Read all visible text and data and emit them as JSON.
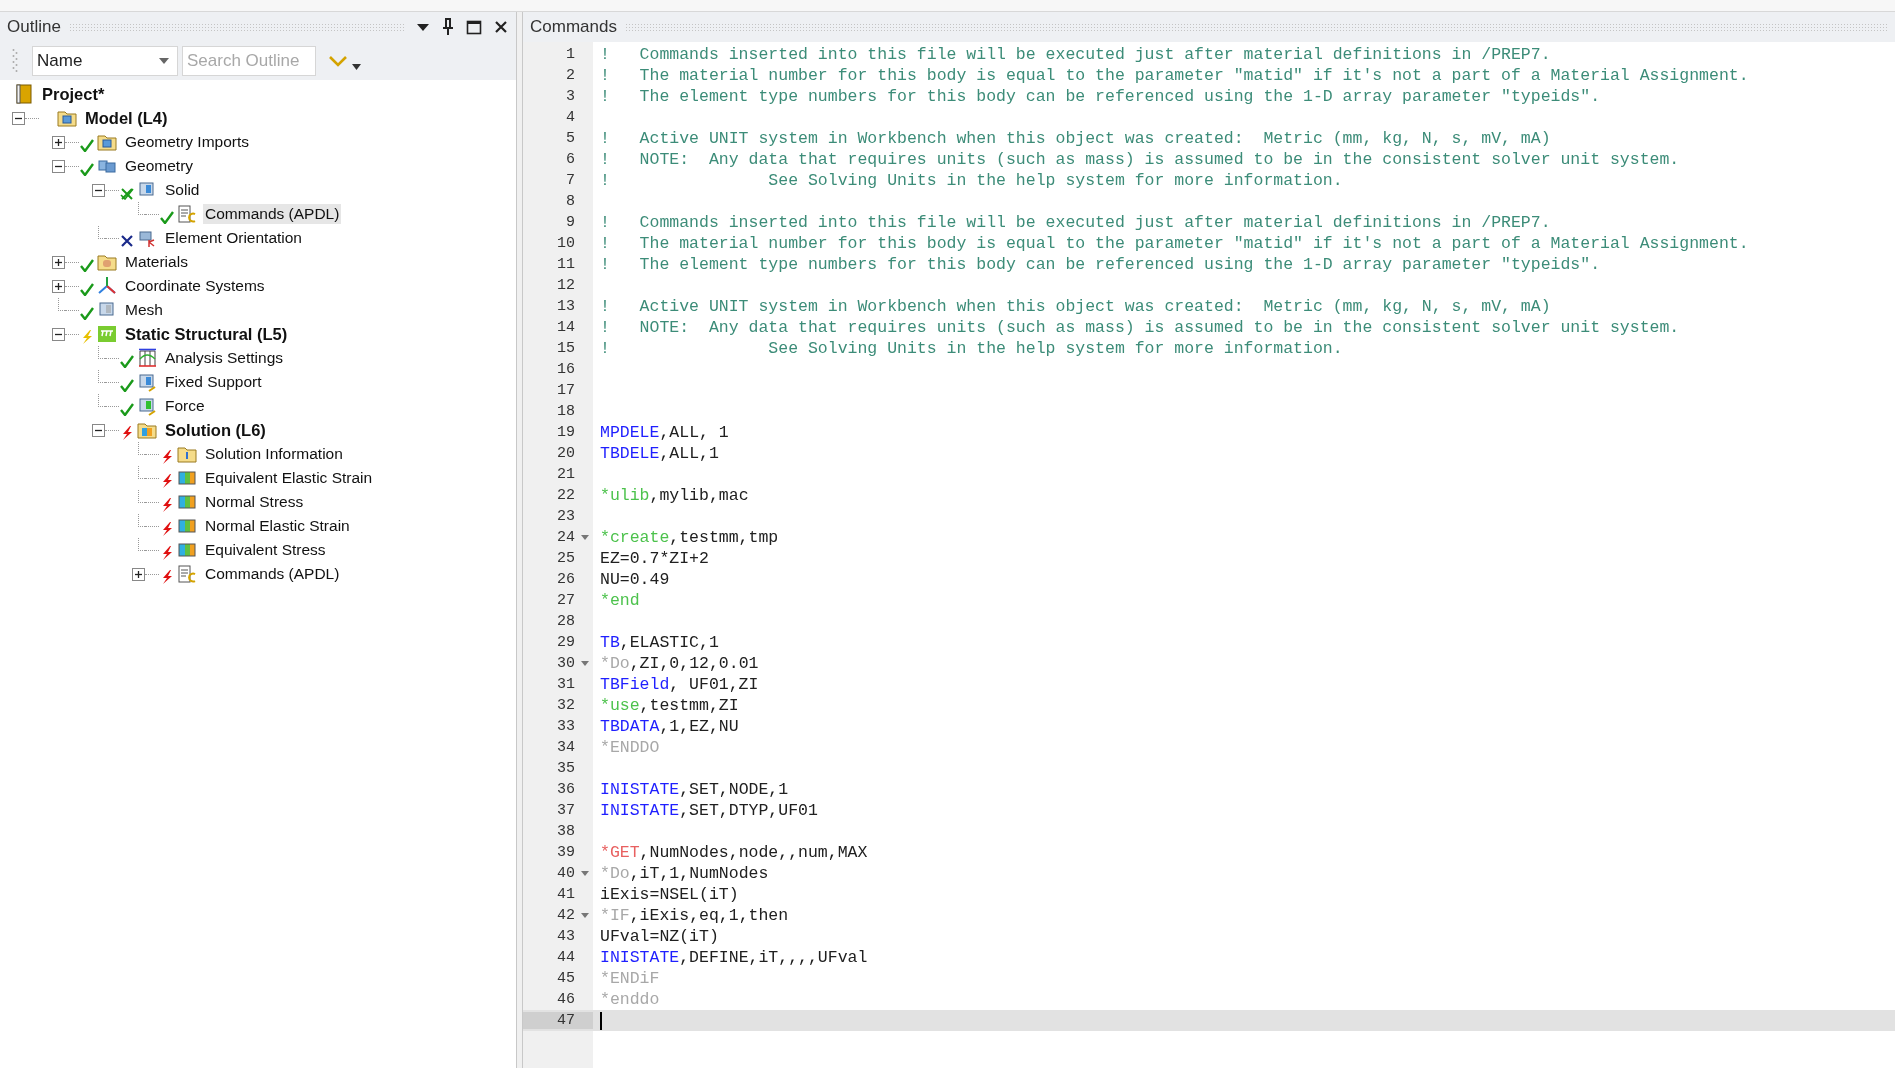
{
  "outline": {
    "title": "Outline",
    "sort": {
      "value": "Name"
    },
    "search": {
      "placeholder": "Search Outline"
    },
    "tree": [
      {
        "label": "Project*",
        "kind": "project",
        "bold": true,
        "selected": false,
        "children": [
          {
            "label": "Model (L4)",
            "kind": "model",
            "bold": true,
            "selected": false,
            "expanded": true,
            "children": [
              {
                "label": "Geometry Imports",
                "kind": "geometry-imports",
                "status": {
                  "kind": "ok"
                },
                "bold": false,
                "selected": false,
                "expanded": false
              },
              {
                "label": "Geometry",
                "kind": "geometry",
                "status": {
                  "kind": "ok"
                },
                "bold": false,
                "selected": false,
                "expanded": true,
                "children": [
                  {
                    "label": "Solid",
                    "kind": "body",
                    "status": {
                      "kind": "partial"
                    },
                    "bold": false,
                    "selected": false,
                    "expanded": true,
                    "children": [
                      {
                        "label": "Commands (APDL)",
                        "kind": "commands",
                        "status": {
                          "kind": "ok"
                        },
                        "bold": false,
                        "selected": true
                      }
                    ]
                  },
                  {
                    "label": "Element Orientation",
                    "kind": "orientation",
                    "status": {
                      "kind": "suppressed"
                    },
                    "bold": false,
                    "selected": false
                  }
                ]
              },
              {
                "label": "Materials",
                "kind": "materials",
                "status": {
                  "kind": "ok"
                },
                "bold": false,
                "selected": false,
                "expanded": false
              },
              {
                "label": "Coordinate Systems",
                "kind": "coordinates",
                "status": {
                  "kind": "ok"
                },
                "bold": false,
                "selected": false,
                "expanded": false
              },
              {
                "label": "Mesh",
                "kind": "mesh",
                "status": {
                  "kind": "ok"
                },
                "bold": false,
                "selected": false
              },
              {
                "label": "Static Structural (L5)",
                "kind": "analysis",
                "status": {
                  "kind": "pending"
                },
                "bold": true,
                "selected": false,
                "expanded": true,
                "children": [
                  {
                    "label": "Analysis Settings",
                    "kind": "settings",
                    "status": {
                      "kind": "ok"
                    },
                    "bold": false,
                    "selected": false
                  },
                  {
                    "label": "Fixed Support",
                    "kind": "support",
                    "status": {
                      "kind": "ok"
                    },
                    "bold": false,
                    "selected": false
                  },
                  {
                    "label": "Force",
                    "kind": "force",
                    "status": {
                      "kind": "ok"
                    },
                    "bold": false,
                    "selected": false
                  },
                  {
                    "label": "Solution (L6)",
                    "kind": "solution",
                    "status": {
                      "kind": "error"
                    },
                    "bold": true,
                    "selected": false,
                    "expanded": true,
                    "children": [
                      {
                        "label": "Solution Information",
                        "kind": "info",
                        "status": {
                          "kind": "error"
                        },
                        "bold": false,
                        "selected": false
                      },
                      {
                        "label": "Equivalent Elastic Strain",
                        "kind": "result",
                        "status": {
                          "kind": "error"
                        },
                        "bold": false,
                        "selected": false
                      },
                      {
                        "label": "Normal Stress",
                        "kind": "result",
                        "status": {
                          "kind": "error"
                        },
                        "bold": false,
                        "selected": false
                      },
                      {
                        "label": "Normal Elastic Strain",
                        "kind": "result",
                        "status": {
                          "kind": "error"
                        },
                        "bold": false,
                        "selected": false
                      },
                      {
                        "label": "Equivalent Stress",
                        "kind": "result",
                        "status": {
                          "kind": "error"
                        },
                        "bold": false,
                        "selected": false
                      },
                      {
                        "label": "Commands (APDL)",
                        "kind": "commands",
                        "status": {
                          "kind": "error"
                        },
                        "bold": false,
                        "selected": false,
                        "expanded": false
                      }
                    ]
                  }
                ]
              }
            ]
          }
        ]
      }
    ]
  },
  "editor": {
    "title": "Commands",
    "lines": [
      {
        "n": "1",
        "fold": false,
        "current": false,
        "tokens": [
          {
            "kind": "comment",
            "text": "!   Commands inserted into this file will be executed just after material definitions in /PREP7."
          }
        ]
      },
      {
        "n": "2",
        "fold": false,
        "current": false,
        "tokens": [
          {
            "kind": "comment",
            "text": "!   The material number for this body is equal to the parameter \"matid\" if it's not a part of a Material Assignment."
          }
        ]
      },
      {
        "n": "3",
        "fold": false,
        "current": false,
        "tokens": [
          {
            "kind": "comment",
            "text": "!   The element type numbers for this body can be referenced using the 1-D array parameter \"typeids\"."
          }
        ]
      },
      {
        "n": "4",
        "fold": false,
        "current": false
      },
      {
        "n": "5",
        "fold": false,
        "current": false,
        "tokens": [
          {
            "kind": "comment",
            "text": "!   Active UNIT system in Workbench when this object was created:  Metric (mm, kg, N, s, mV, mA)"
          }
        ]
      },
      {
        "n": "6",
        "fold": false,
        "current": false,
        "tokens": [
          {
            "kind": "comment",
            "text": "!   NOTE:  Any data that requires units (such as mass) is assumed to be in the consistent solver unit system."
          }
        ]
      },
      {
        "n": "7",
        "fold": false,
        "current": false,
        "tokens": [
          {
            "kind": "comment",
            "text": "!                See Solving Units in the help system for more information."
          }
        ]
      },
      {
        "n": "8",
        "fold": false,
        "current": false
      },
      {
        "n": "9",
        "fold": false,
        "current": false,
        "tokens": [
          {
            "kind": "comment",
            "text": "!   Commands inserted into this file will be executed just after material definitions in /PREP7."
          }
        ]
      },
      {
        "n": "10",
        "fold": false,
        "current": false,
        "tokens": [
          {
            "kind": "comment",
            "text": "!   The material number for this body is equal to the parameter \"matid\" if it's not a part of a Material Assignment."
          }
        ]
      },
      {
        "n": "11",
        "fold": false,
        "current": false,
        "tokens": [
          {
            "kind": "comment",
            "text": "!   The element type numbers for this body can be referenced using the 1-D array parameter \"typeids\"."
          }
        ]
      },
      {
        "n": "12",
        "fold": false,
        "current": false
      },
      {
        "n": "13",
        "fold": false,
        "current": false,
        "tokens": [
          {
            "kind": "comment",
            "text": "!   Active UNIT system in Workbench when this object was created:  Metric (mm, kg, N, s, mV, mA)"
          }
        ]
      },
      {
        "n": "14",
        "fold": false,
        "current": false,
        "tokens": [
          {
            "kind": "comment",
            "text": "!   NOTE:  Any data that requires units (such as mass) is assumed to be in the consistent solver unit system."
          }
        ]
      },
      {
        "n": "15",
        "fold": false,
        "current": false,
        "tokens": [
          {
            "kind": "comment",
            "text": "!                See Solving Units in the help system for more information."
          }
        ]
      },
      {
        "n": "16",
        "fold": false,
        "current": false
      },
      {
        "n": "17",
        "fold": false,
        "current": false
      },
      {
        "n": "18",
        "fold": false,
        "current": false
      },
      {
        "n": "19",
        "fold": false,
        "current": false,
        "tokens": [
          {
            "kind": "command",
            "text": "MPDELE"
          },
          {
            "kind": "plain",
            "text": ",ALL, 1"
          }
        ]
      },
      {
        "n": "20",
        "fold": false,
        "current": false,
        "tokens": [
          {
            "kind": "command",
            "text": "TBDELE"
          },
          {
            "kind": "plain",
            "text": ",ALL,1"
          }
        ]
      },
      {
        "n": "21",
        "fold": false,
        "current": false
      },
      {
        "n": "22",
        "fold": false,
        "current": false,
        "tokens": [
          {
            "kind": "macro",
            "text": "*ulib"
          },
          {
            "kind": "plain",
            "text": ",mylib,mac"
          }
        ]
      },
      {
        "n": "23",
        "fold": false,
        "current": false
      },
      {
        "n": "24",
        "fold": true,
        "current": false,
        "tokens": [
          {
            "kind": "macro",
            "text": "*create"
          },
          {
            "kind": "plain",
            "text": ",testmm,tmp"
          }
        ]
      },
      {
        "n": "25",
        "fold": false,
        "current": false,
        "tokens": [
          {
            "kind": "plain",
            "text": "EZ=0.7*ZI+2"
          }
        ]
      },
      {
        "n": "26",
        "fold": false,
        "current": false,
        "tokens": [
          {
            "kind": "plain",
            "text": "NU=0.49"
          }
        ]
      },
      {
        "n": "27",
        "fold": false,
        "current": false,
        "tokens": [
          {
            "kind": "macro",
            "text": "*end"
          }
        ]
      },
      {
        "n": "28",
        "fold": false,
        "current": false
      },
      {
        "n": "29",
        "fold": false,
        "current": false,
        "tokens": [
          {
            "kind": "command",
            "text": "TB"
          },
          {
            "kind": "plain",
            "text": ",ELASTIC,1"
          }
        ]
      },
      {
        "n": "30",
        "fold": true,
        "current": false,
        "tokens": [
          {
            "kind": "control",
            "text": "*Do"
          },
          {
            "kind": "plain",
            "text": ",ZI,0,12,0.01"
          }
        ]
      },
      {
        "n": "31",
        "fold": false,
        "current": false,
        "tokens": [
          {
            "kind": "command",
            "text": "TBField"
          },
          {
            "kind": "plain",
            "text": ", UF01,ZI"
          }
        ]
      },
      {
        "n": "32",
        "fold": false,
        "current": false,
        "tokens": [
          {
            "kind": "macro",
            "text": "*use"
          },
          {
            "kind": "plain",
            "text": ",testmm,ZI"
          }
        ]
      },
      {
        "n": "33",
        "fold": false,
        "current": false,
        "tokens": [
          {
            "kind": "command",
            "text": "TBDATA"
          },
          {
            "kind": "plain",
            "text": ",1,EZ,NU"
          }
        ]
      },
      {
        "n": "34",
        "fold": false,
        "current": false,
        "tokens": [
          {
            "kind": "control",
            "text": "*ENDDO"
          }
        ]
      },
      {
        "n": "35",
        "fold": false,
        "current": false
      },
      {
        "n": "36",
        "fold": false,
        "current": false,
        "tokens": [
          {
            "kind": "command",
            "text": "INISTATE"
          },
          {
            "kind": "plain",
            "text": ",SET,NODE,1"
          }
        ]
      },
      {
        "n": "37",
        "fold": false,
        "current": false,
        "tokens": [
          {
            "kind": "command",
            "text": "INISTATE"
          },
          {
            "kind": "plain",
            "text": ",SET,DTYP,UF01"
          }
        ]
      },
      {
        "n": "38",
        "fold": false,
        "current": false
      },
      {
        "n": "39",
        "fold": false,
        "current": false,
        "tokens": [
          {
            "kind": "get",
            "text": "*GET"
          },
          {
            "kind": "plain",
            "text": ",NumNodes,node,,num,MAX"
          }
        ]
      },
      {
        "n": "40",
        "fold": true,
        "current": false,
        "tokens": [
          {
            "kind": "control",
            "text": "*Do"
          },
          {
            "kind": "plain",
            "text": ",iT,1,NumNodes"
          }
        ]
      },
      {
        "n": "41",
        "fold": false,
        "current": false,
        "tokens": [
          {
            "kind": "plain",
            "text": "iExis=NSEL(iT)"
          }
        ]
      },
      {
        "n": "42",
        "fold": true,
        "current": false,
        "tokens": [
          {
            "kind": "control",
            "text": "*IF"
          },
          {
            "kind": "plain",
            "text": ",iExis,eq,1,then"
          }
        ]
      },
      {
        "n": "43",
        "fold": false,
        "current": false,
        "tokens": [
          {
            "kind": "plain",
            "text": "UFval=NZ(iT)"
          }
        ]
      },
      {
        "n": "44",
        "fold": false,
        "current": false,
        "tokens": [
          {
            "kind": "command",
            "text": "INISTATE"
          },
          {
            "kind": "plain",
            "text": ",DEFINE,iT,,,,UFval"
          }
        ]
      },
      {
        "n": "45",
        "fold": false,
        "current": false,
        "tokens": [
          {
            "kind": "control",
            "text": "*ENDiF"
          }
        ]
      },
      {
        "n": "46",
        "fold": false,
        "current": false,
        "tokens": [
          {
            "kind": "control",
            "text": "*enddo"
          }
        ]
      },
      {
        "n": "47",
        "fold": false,
        "current": true
      }
    ]
  }
}
